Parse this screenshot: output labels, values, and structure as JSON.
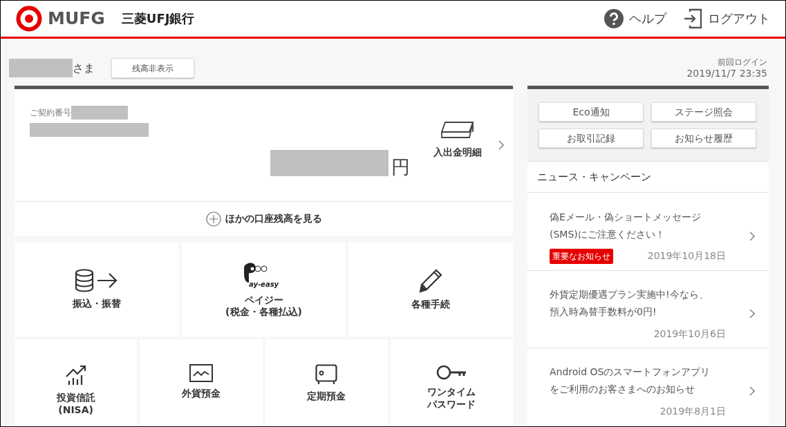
{
  "header": {
    "logo_mark": "MUFG",
    "bank_name": "三菱UFJ銀行",
    "help": "ヘルプ",
    "logout": "ログアウト"
  },
  "greeting": {
    "honorific": "さま",
    "hide_balance_button": "残高非表示",
    "last_login_label": "前回ログイン",
    "last_login_time": "2019/11/7 23:35"
  },
  "account": {
    "contract_label": "ご契約番号",
    "currency": "円",
    "statement_link": "入出金明細",
    "other_accounts": "ほかの口座残高を見る"
  },
  "menu_rows": [
    [
      {
        "kind": "transfer",
        "lines": [
          "振込・振替"
        ]
      },
      {
        "kind": "payeasy",
        "logo": "ay-easy",
        "lines": [
          "ペイジー",
          "(税金・各種払込)"
        ]
      },
      {
        "kind": "pencil",
        "lines": [
          "各種手続"
        ]
      }
    ],
    [
      {
        "kind": "chart",
        "lines": [
          "投資信託",
          "(NISA)"
        ]
      },
      {
        "kind": "fx",
        "lines": [
          "外貨預金"
        ]
      },
      {
        "kind": "safe",
        "lines": [
          "定期預金"
        ]
      },
      {
        "kind": "key",
        "lines": [
          "ワンタイム",
          "パスワード"
        ]
      }
    ]
  ],
  "quick_buttons": [
    "Eco通知",
    "ステージ照会",
    "お取引記録",
    "お知らせ履歴"
  ],
  "news": {
    "title": "ニュース・キャンペーン",
    "items": [
      {
        "lines": [
          "偽Eメール・偽ショートメッセージ",
          "(SMS)にご注意ください！"
        ],
        "tag": {
          "label": "重要なお知らせ",
          "color": "#e60000"
        },
        "date": "2019年10月18日"
      },
      {
        "lines": [
          "外貨定期優遇プラン実施中!今なら、",
          "預入時為替手数料が0円!"
        ],
        "date": "2019年10月6日"
      },
      {
        "lines": [
          "Android OSのスマートフォンアプリ",
          "をご利用のお客さまへのお知らせ"
        ],
        "date": "2019年8月1日"
      }
    ]
  }
}
